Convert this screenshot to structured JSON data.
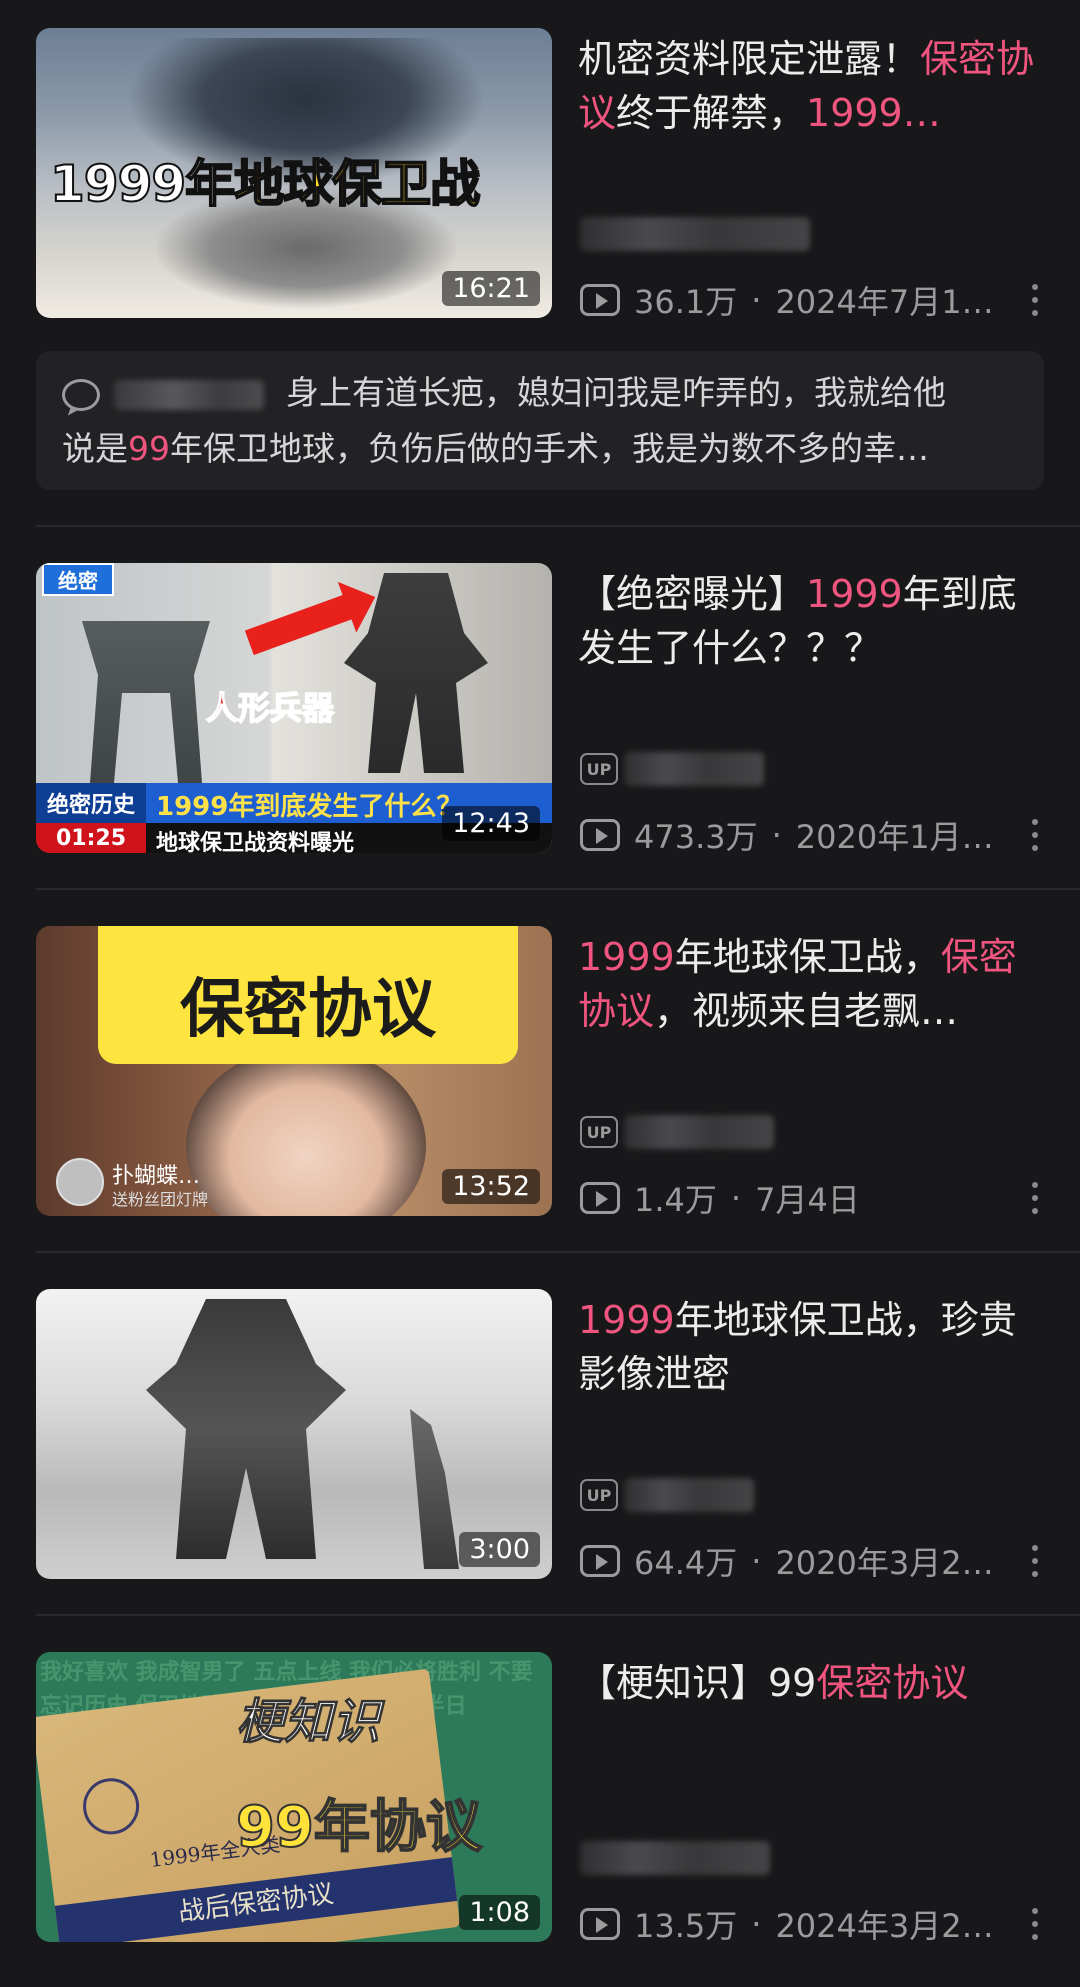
{
  "videos": [
    {
      "title_parts": [
        {
          "text": "机密资料限定泄露！",
          "hl": false
        },
        {
          "text": "保密协议",
          "hl": true
        },
        {
          "text": "终于解禁，",
          "hl": false
        },
        {
          "text": "1999…",
          "hl": true
        }
      ],
      "thumb_caption_white": "1999年",
      "thumb_caption_yellow": "地球保卫战",
      "duration": "16:21",
      "views": "36.1万",
      "date": "2024年7月1…"
    },
    {
      "title_parts": [
        {
          "text": "【绝密曝光】",
          "hl": false
        },
        {
          "text": "1999",
          "hl": true
        },
        {
          "text": "年到底发生了什么？？？",
          "hl": false
        }
      ],
      "thumb_tag": "绝密",
      "thumb_red": "人形兵器",
      "thumb_bar_label": "绝密历史",
      "thumb_bar_text": "1999年到底发生了什么？",
      "thumb_time": "01:25",
      "thumb_bar2_text": "地球保卫战资料曝光",
      "duration": "12:43",
      "views": "473.3万",
      "date": "2020年1月…"
    },
    {
      "title_parts": [
        {
          "text": "1999",
          "hl": true
        },
        {
          "text": "年地球保卫战，",
          "hl": false
        },
        {
          "text": "保密协议",
          "hl": true
        },
        {
          "text": "，视频来自老飘…",
          "hl": false
        }
      ],
      "thumb_card": "保密协议",
      "thumb_name": "扑蝴蝶…",
      "thumb_sub": "送粉丝团灯牌",
      "duration": "13:52",
      "views": "1.4万",
      "date": "7月4日"
    },
    {
      "title_parts": [
        {
          "text": "1999",
          "hl": true
        },
        {
          "text": "年地球保卫战，珍贵影像泄密",
          "hl": false
        }
      ],
      "duration": "3:00",
      "views": "64.4万",
      "date": "2020年3月2…"
    },
    {
      "title_parts": [
        {
          "text": "【梗知识】99",
          "hl": false
        },
        {
          "text": "保密协议",
          "hl": true
        }
      ],
      "thumb_big": "梗知识",
      "thumb_yellow": "99年协议",
      "thumb_folder_text": "1999年全人类",
      "thumb_band": "战后保密协议",
      "thumb_bg": "我好喜欢 我成智男了 五点上线 我们必将胜利 不要忘记历史 保卫地球 记得保密 我有许可 半日",
      "duration": "1:08",
      "views": "13.5万",
      "date": "2024年3月2…"
    }
  ],
  "comment": {
    "line1": "身上有道长疤，媳妇问我是咋弄的，我就给他",
    "line2_pre": "说是",
    "line2_hl": "99",
    "line2_post": "年保卫地球，负伤后做的手术，我是为数不多的幸…"
  },
  "labels": {
    "up": "UP",
    "dot": "·"
  }
}
